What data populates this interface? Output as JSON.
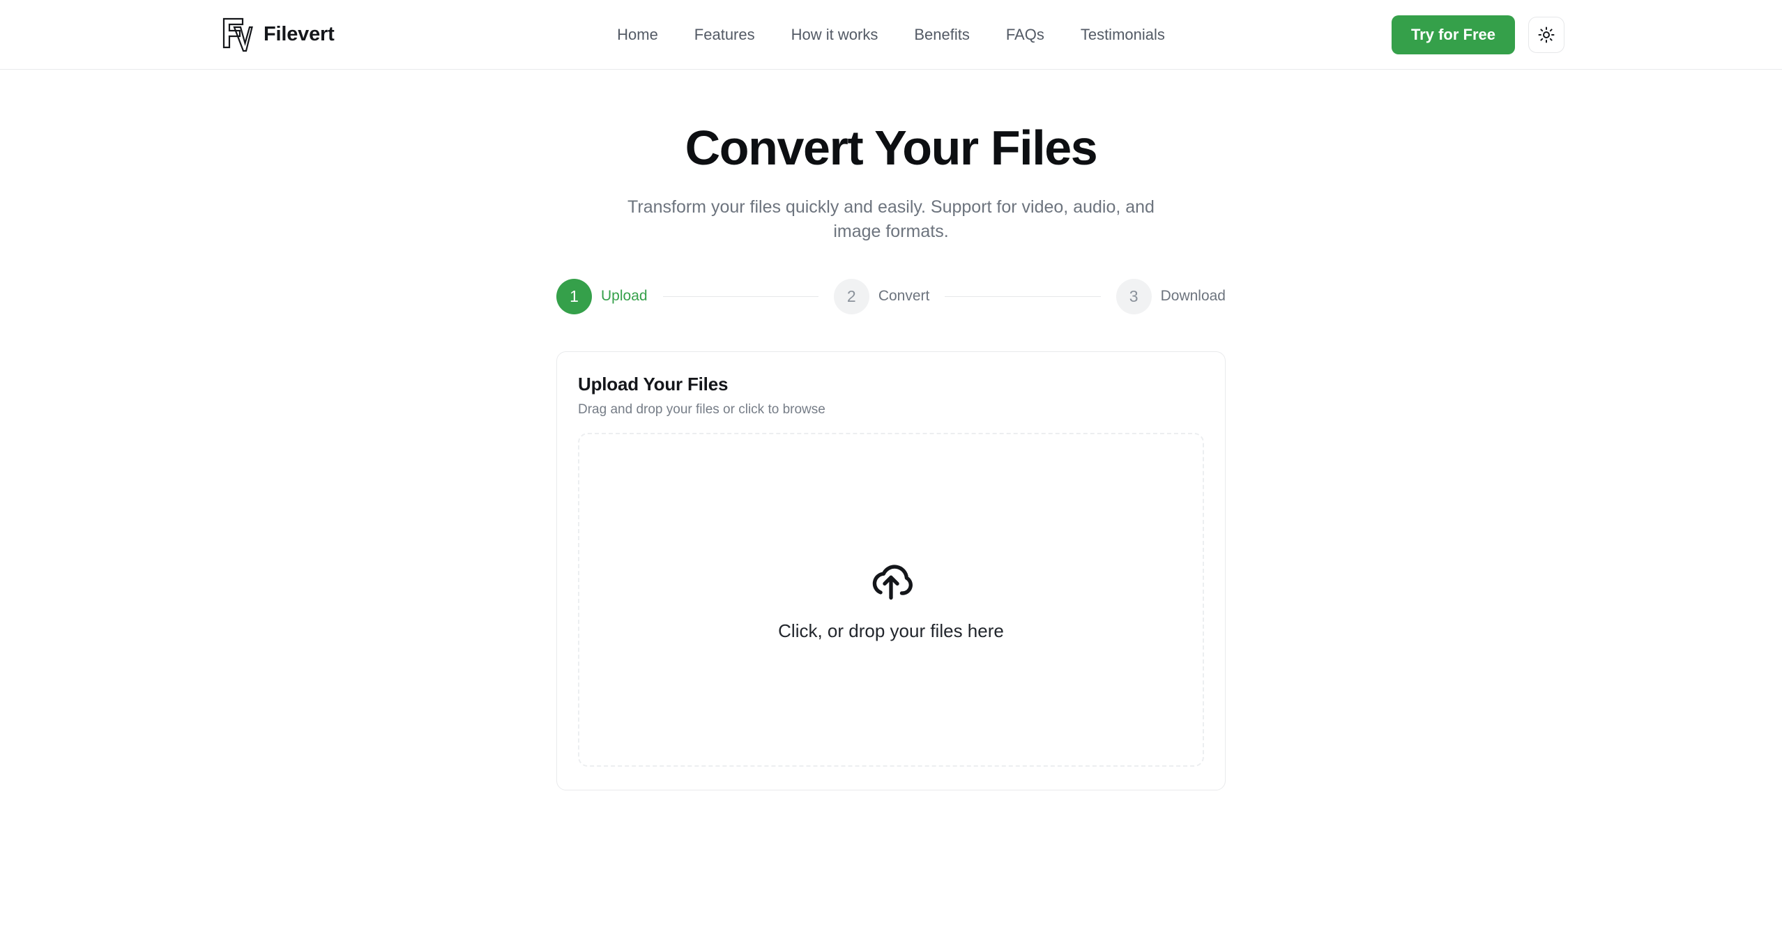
{
  "brand": {
    "name": "Filevert",
    "logo_icon": "fv-monogram-icon"
  },
  "nav": {
    "items": [
      {
        "label": "Home"
      },
      {
        "label": "Features"
      },
      {
        "label": "How it works"
      },
      {
        "label": "Benefits"
      },
      {
        "label": "FAQs"
      },
      {
        "label": "Testimonials"
      }
    ]
  },
  "header_actions": {
    "cta_label": "Try for Free",
    "theme_toggle_icon": "sun-icon"
  },
  "hero": {
    "title": "Convert Your Files",
    "subtitle": "Transform your files quickly and easily. Support for video, audio, and image formats."
  },
  "stepper": {
    "steps": [
      {
        "number": "1",
        "label": "Upload"
      },
      {
        "number": "2",
        "label": "Convert"
      },
      {
        "number": "3",
        "label": "Download"
      }
    ],
    "active_index": 0
  },
  "upload_card": {
    "title": "Upload Your Files",
    "subtitle": "Drag and drop your files or click to browse",
    "dropzone": {
      "icon": "cloud-upload-icon",
      "text": "Click, or drop your files here"
    }
  },
  "colors": {
    "accent_green": "#35a04a",
    "text_primary": "#14161a",
    "text_muted": "#6d747e",
    "border": "#e9eaec",
    "step_inactive_bg": "#f1f2f3"
  }
}
